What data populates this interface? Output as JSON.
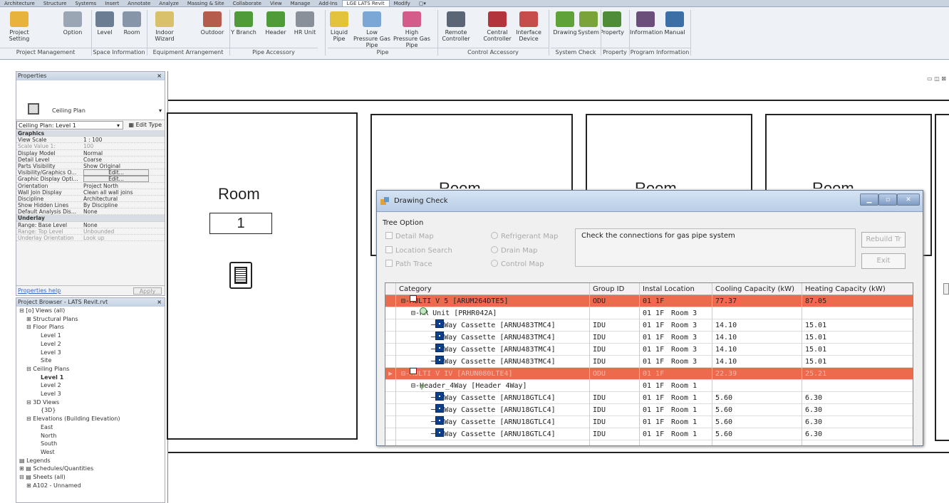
{
  "ribbon_tabs": [
    "Architecture",
    "Structure",
    "Systems",
    "Insert",
    "Annotate",
    "Analyze",
    "Massing & Site",
    "Collaborate",
    "View",
    "Manage",
    "Add-Ins",
    "LGE LATS Revit",
    "Modify",
    "▢▾"
  ],
  "ribbon_active_tab": "LGE LATS Revit",
  "ribbon": {
    "buttons": [
      {
        "label": "Project Setting",
        "color": "#e8b33a"
      },
      {
        "label": "Option",
        "color": "#9aa6b3"
      },
      {
        "label": "Level",
        "color": "#6b7d93"
      },
      {
        "label": "Room",
        "color": "#8795a8"
      },
      {
        "label": "Indoor Wizard",
        "color": "#d9c06a"
      },
      {
        "label": "Outdoor",
        "color": "#b65c4c"
      },
      {
        "label": "Y Branch",
        "color": "#4f9b3a"
      },
      {
        "label": "Header",
        "color": "#4f9b3a"
      },
      {
        "label": "HR Unit",
        "color": "#8a9099"
      },
      {
        "label": "Liquid Pipe",
        "color": "#e3c33c"
      },
      {
        "label": "Low Pressure Gas Pipe",
        "color": "#7aa7d6"
      },
      {
        "label": "High Pressure Gas Pipe",
        "color": "#d45c8a"
      },
      {
        "label": "Remote Controller",
        "color": "#5a6676"
      },
      {
        "label": "Central Controller",
        "color": "#b3343a"
      },
      {
        "label": "Interface Device",
        "color": "#c74d4d"
      },
      {
        "label": "Drawing",
        "color": "#5fa23a"
      },
      {
        "label": "System",
        "color": "#7aa33a"
      },
      {
        "label": "Property",
        "color": "#4e8c3a"
      },
      {
        "label": "Information",
        "color": "#6c4e7a"
      },
      {
        "label": "Manual",
        "color": "#3b6fa6"
      }
    ],
    "groups": [
      "Project Management",
      "Space Information",
      "Equipment Arrangement",
      "Pipe Accessory",
      "Pipe",
      "Control Accessory",
      "System Check",
      "Property",
      "Program Information"
    ]
  },
  "properties": {
    "title": "Properties",
    "type_name": "Ceiling Plan",
    "selector": "Ceiling Plan: Level 1",
    "edit_type": "Edit Type",
    "rows": [
      {
        "k": "Graphics",
        "v": "",
        "hd": true
      },
      {
        "k": "View Scale",
        "v": "1 : 100"
      },
      {
        "k": "Scale Value    1:",
        "v": "100",
        "dim": true
      },
      {
        "k": "Display Model",
        "v": "Normal"
      },
      {
        "k": "Detail Level",
        "v": "Coarse"
      },
      {
        "k": "Parts Visibility",
        "v": "Show Original"
      },
      {
        "k": "Visibility/Graphics O...",
        "v": "Edit...",
        "btn": true
      },
      {
        "k": "Graphic Display Opti...",
        "v": "Edit...",
        "btn": true
      },
      {
        "k": "Orientation",
        "v": "Project North"
      },
      {
        "k": "Wall Join Display",
        "v": "Clean all wall joins"
      },
      {
        "k": "Discipline",
        "v": "Architectural"
      },
      {
        "k": "Show Hidden Lines",
        "v": "By Discipline"
      },
      {
        "k": "Default Analysis Dis...",
        "v": "None"
      },
      {
        "k": "Underlay",
        "v": "",
        "hd": true
      },
      {
        "k": "Range: Base Level",
        "v": "None"
      },
      {
        "k": "Range: Top Level",
        "v": "Unbounded",
        "dim": true
      },
      {
        "k": "Underlay Orientation",
        "v": "Look up",
        "dim": true
      }
    ],
    "help": "Properties help",
    "apply": "Apply"
  },
  "browser": {
    "title": "Project Browser - LATS Revit.rvt",
    "items": [
      {
        "t": "⊟ [o] Views (all)",
        "i": 0
      },
      {
        "t": "⊞ Structural Plans",
        "i": 1
      },
      {
        "t": "⊟ Floor Plans",
        "i": 1
      },
      {
        "t": "Level 1",
        "i": 3
      },
      {
        "t": "Level 2",
        "i": 3
      },
      {
        "t": "Level 3",
        "i": 3
      },
      {
        "t": "Site",
        "i": 3
      },
      {
        "t": "⊟ Ceiling Plans",
        "i": 1
      },
      {
        "t": "Level 1",
        "i": 3,
        "b": true
      },
      {
        "t": "Level 2",
        "i": 3
      },
      {
        "t": "Level 3",
        "i": 3
      },
      {
        "t": "⊟ 3D Views",
        "i": 1
      },
      {
        "t": "{3D}",
        "i": 3
      },
      {
        "t": "⊟ Elevations (Building Elevation)",
        "i": 1
      },
      {
        "t": "East",
        "i": 3
      },
      {
        "t": "North",
        "i": 3
      },
      {
        "t": "South",
        "i": 3
      },
      {
        "t": "West",
        "i": 3
      },
      {
        "t": "▤ Legends",
        "i": 0
      },
      {
        "t": "⊞ ▤ Schedules/Quantities",
        "i": 0
      },
      {
        "t": "⊟ ▤ Sheets (all)",
        "i": 0
      },
      {
        "t": "⊞ A102 - Unnamed",
        "i": 1
      }
    ]
  },
  "canvas": {
    "room_label": "Room",
    "room_number": "1",
    "window_controls": "▭ ◫ ⊠"
  },
  "dialog": {
    "title": "Drawing Check",
    "tree_option": "Tree Option",
    "checks": [
      "Detail Map",
      "Location Search",
      "Path Trace"
    ],
    "radios": [
      "Refrigerant Map",
      "Drain Map",
      "Control Map"
    ],
    "message": "Check the connections for gas pipe system",
    "rebuild": "Rebuild Tr",
    "exit": "Exit",
    "headers": [
      "Category",
      "Group ID",
      "Instal Location",
      "Cooling Capacity (kW)",
      "Heating Capacity (kW)"
    ],
    "rows": [
      {
        "cat": "MULTI V 5 [ARUM264DTE5]",
        "g": "ODU",
        "f": "01 1F",
        "r": "",
        "c": "77.37",
        "h": "87.05",
        "lv": 0,
        "type": "odu",
        "red": "red"
      },
      {
        "cat": "HR Unit [PRHR042A]",
        "g": "",
        "f": "01 1F",
        "r": "Room 3",
        "c": "",
        "h": "",
        "lv": 1,
        "type": "hr"
      },
      {
        "cat": "4 Way Cassette [ARNU483TMC4]",
        "g": "IDU",
        "f": "01 1F",
        "r": "Room 3",
        "c": "14.10",
        "h": "15.01",
        "lv": 2,
        "type": "idu"
      },
      {
        "cat": "4 Way Cassette [ARNU483TMC4]",
        "g": "IDU",
        "f": "01 1F",
        "r": "Room 3",
        "c": "14.10",
        "h": "15.01",
        "lv": 2,
        "type": "idu"
      },
      {
        "cat": "4 Way Cassette [ARNU483TMC4]",
        "g": "IDU",
        "f": "01 1F",
        "r": "Room 3",
        "c": "14.10",
        "h": "15.01",
        "lv": 2,
        "type": "idu"
      },
      {
        "cat": "4 Way Cassette [ARNU483TMC4]",
        "g": "IDU",
        "f": "01 1F",
        "r": "Room 3",
        "c": "14.10",
        "h": "15.01",
        "lv": 2,
        "type": "idu"
      },
      {
        "cat": "MULTI V IV [ARUN080LTE4]",
        "g": "ODU",
        "f": "01 1F",
        "r": "",
        "c": "22.39",
        "h": "25.21",
        "lv": 0,
        "type": "odu",
        "red": "red2",
        "cur": true
      },
      {
        "cat": "Header_4Way [Header 4Way]",
        "g": "",
        "f": "01 1F",
        "r": "Room 1",
        "c": "",
        "h": "",
        "lv": 1,
        "type": "hd"
      },
      {
        "cat": "2 Way Cassette [ARNU18GTLC4]",
        "g": "IDU",
        "f": "01 1F",
        "r": "Room 1",
        "c": "5.60",
        "h": "6.30",
        "lv": 2,
        "type": "idu"
      },
      {
        "cat": "2 Way Cassette [ARNU18GTLC4]",
        "g": "IDU",
        "f": "01 1F",
        "r": "Room 1",
        "c": "5.60",
        "h": "6.30",
        "lv": 2,
        "type": "idu"
      },
      {
        "cat": "2 Way Cassette [ARNU18GTLC4]",
        "g": "IDU",
        "f": "01 1F",
        "r": "Room 1",
        "c": "5.60",
        "h": "6.30",
        "lv": 2,
        "type": "idu"
      },
      {
        "cat": "2 Way Cassette [ARNU18GTLC4]",
        "g": "IDU",
        "f": "01 1F",
        "r": "Room 1",
        "c": "5.60",
        "h": "6.30",
        "lv": 2,
        "type": "idu"
      }
    ]
  }
}
